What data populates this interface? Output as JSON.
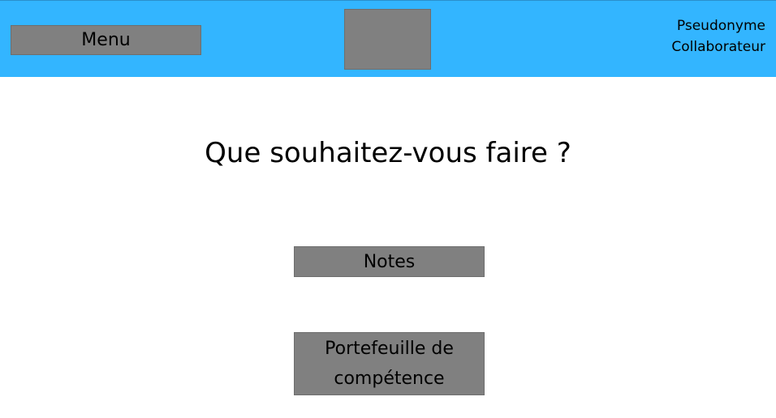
{
  "header": {
    "menu_label": "Menu",
    "user": {
      "pseudonym": "Pseudonyme",
      "role": "Collaborateur"
    },
    "colors": {
      "bar": "#33b5ff",
      "placeholder": "#808080"
    }
  },
  "main": {
    "question": "Que souhaitez-vous faire ?",
    "actions": [
      {
        "label": "Notes"
      },
      {
        "label": "Portefeuille de compétence"
      }
    ]
  }
}
